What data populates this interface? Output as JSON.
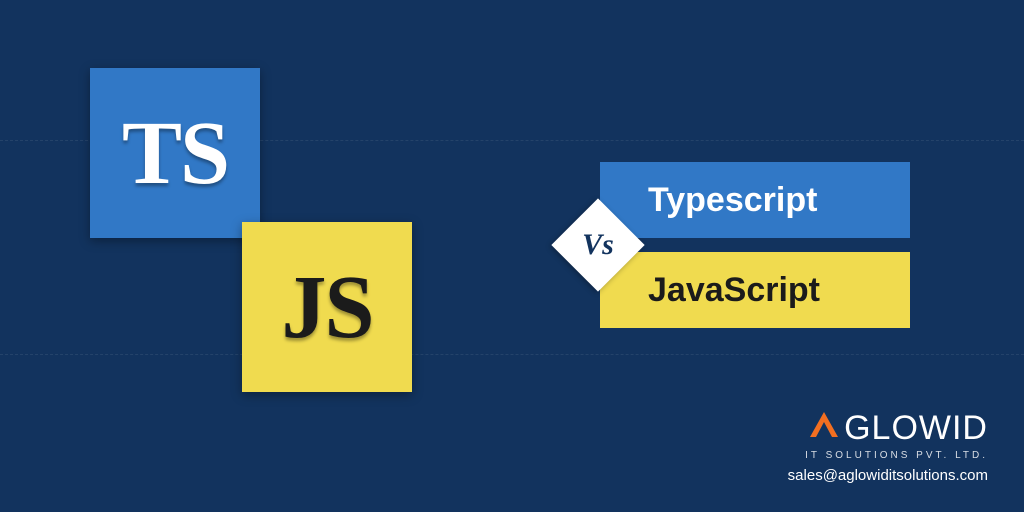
{
  "tiles": {
    "ts_label": "TS",
    "js_label": "JS"
  },
  "bars": {
    "typescript": "Typescript",
    "javascript": "JavaScript"
  },
  "vs_label": "Vs",
  "brand": {
    "name": "GLOWID",
    "subtitle": "IT SOLUTIONS PVT. LTD.",
    "email": "sales@aglowiditsolutions.com"
  },
  "colors": {
    "bg": "#12335e",
    "ts_blue": "#3178c6",
    "js_yellow": "#f0db4f",
    "brand_orange": "#f36f21"
  }
}
